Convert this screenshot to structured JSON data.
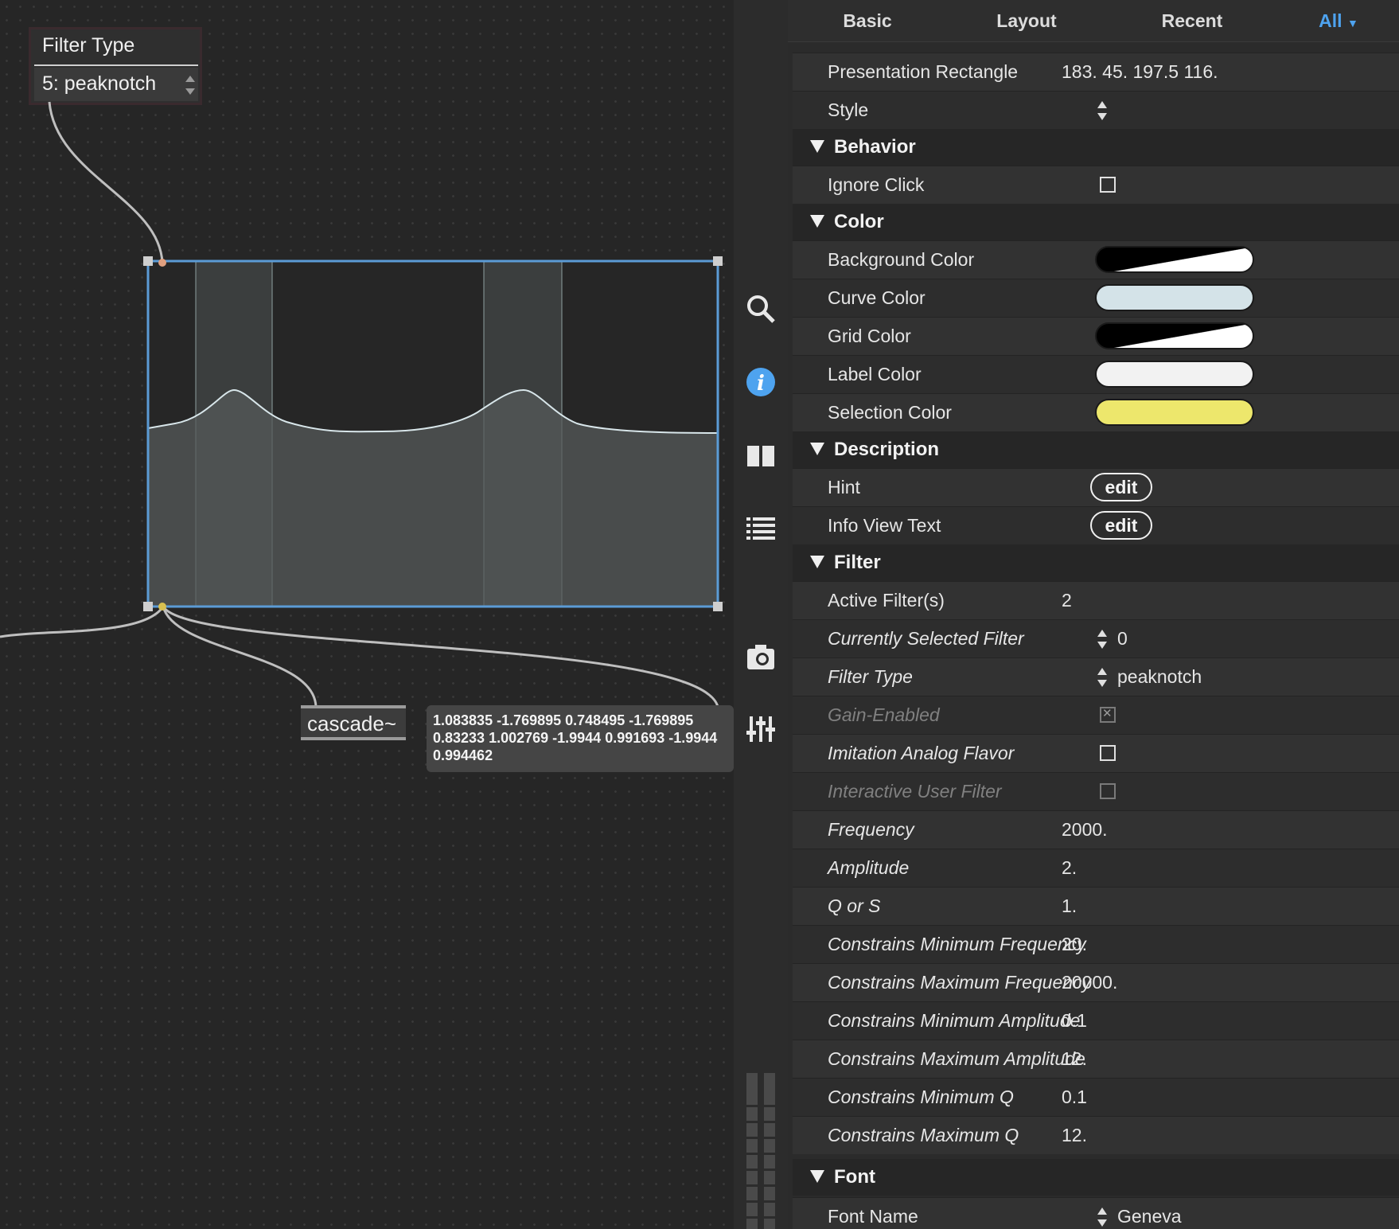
{
  "patcher": {
    "filter_type_label": "Filter Type",
    "filter_type_menu": "5: peaknotch",
    "cascade_object": "cascade~",
    "coeff_message": "1.083835 -1.769895 0.748495 -1.769895 0.83233 1.002769 -1.9944 0.991693 -1.9944 0.994462",
    "colors": {
      "selection_outline": "#5b9bd5",
      "curve_fill": "#555a5a",
      "band_fill": "#5b6060"
    }
  },
  "toolbar": {
    "icons": [
      "search-icon",
      "info-icon",
      "columns-icon",
      "list-icon",
      "camera-icon",
      "mixer-icon",
      "level-meter-icon"
    ]
  },
  "inspector": {
    "tabs": [
      {
        "label": "Basic"
      },
      {
        "label": "Layout"
      },
      {
        "label": "Recent"
      },
      {
        "label": "All"
      }
    ],
    "active_tab": "All",
    "rows": {
      "presentation_rectangle": {
        "label": "Presentation Rectangle",
        "value": "183. 45. 197.5 116."
      },
      "style": {
        "label": "Style"
      },
      "ignore_click": {
        "label": "Ignore Click"
      },
      "background_color": {
        "label": "Background Color"
      },
      "curve_color": {
        "label": "Curve Color",
        "color": "#d4e3e8"
      },
      "grid_color": {
        "label": "Grid Color"
      },
      "label_color": {
        "label": "Label Color",
        "color": "#f2f2f2"
      },
      "selection_color": {
        "label": "Selection Color",
        "color": "#ede76c"
      },
      "hint": {
        "label": "Hint",
        "button": "edit"
      },
      "info_view_text": {
        "label": "Info View Text",
        "button": "edit"
      },
      "active_filters": {
        "label": "Active Filter(s)",
        "value": "2"
      },
      "currently_selected_filter": {
        "label": "Currently Selected Filter",
        "value": "0"
      },
      "filter_type": {
        "label": "Filter Type",
        "value": "peaknotch"
      },
      "gain_enabled": {
        "label": "Gain-Enabled"
      },
      "imitation_analog": {
        "label": "Imitation Analog Flavor"
      },
      "interactive_user_filter": {
        "label": "Interactive User Filter"
      },
      "frequency": {
        "label": "Frequency",
        "value": "2000."
      },
      "amplitude": {
        "label": "Amplitude",
        "value": "2."
      },
      "q_or_s": {
        "label": "Q or S",
        "value": "1."
      },
      "min_freq": {
        "label": "Constrains Minimum Frequency",
        "value": "20."
      },
      "max_freq": {
        "label": "Constrains Maximum Frequency",
        "value": "20000."
      },
      "min_amp": {
        "label": "Constrains Minimum Amplitude",
        "value": "0.1"
      },
      "max_amp": {
        "label": "Constrains Maximum Amplitude",
        "value": "12."
      },
      "min_q": {
        "label": "Constrains Minimum Q",
        "value": "0.1"
      },
      "max_q": {
        "label": "Constrains Maximum Q",
        "value": "12."
      },
      "font_name": {
        "label": "Font Name",
        "value": "Geneva"
      }
    },
    "sections": {
      "behavior": "Behavior",
      "color": "Color",
      "description": "Description",
      "filter": "Filter",
      "font": "Font"
    }
  }
}
